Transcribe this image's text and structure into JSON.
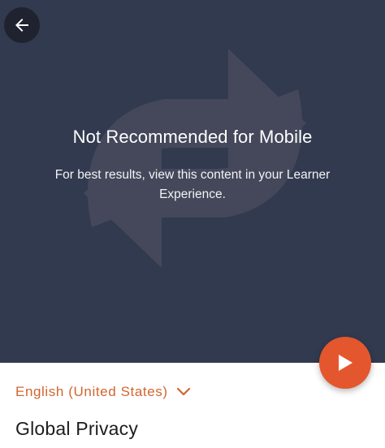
{
  "notice": {
    "title": "Not Recommended for Mobile",
    "body": "For best results, view this content in your Learner Experience."
  },
  "language": {
    "selected": "English (United States)"
  },
  "course": {
    "title": "Global Privacy"
  },
  "icons": {
    "back": "arrow-left-icon",
    "background": "sync-arrows-icon",
    "play": "play-icon",
    "language_toggle": "chevron-down-icon"
  },
  "colors": {
    "hero_background": "#323a4f",
    "accent": "#e4572e",
    "language_text": "#d2652e",
    "back_button": "#1f2330"
  }
}
